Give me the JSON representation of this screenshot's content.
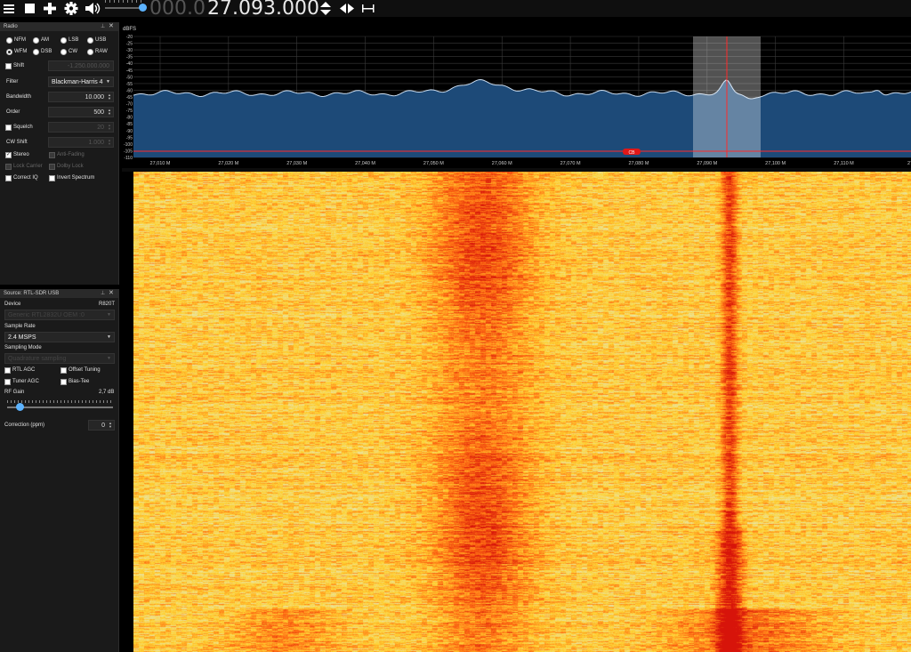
{
  "toolbar": {
    "menu_icon": "hamburger-menu-icon",
    "stop_icon": "stop-icon",
    "add_icon": "plus-icon",
    "settings_icon": "gear-icon",
    "volume_icon": "speaker-icon",
    "volume_level": 0.85,
    "frequency_leading": "000.0",
    "frequency_main": "27.093.000",
    "tuning_icon": "up-down-arrows-icon",
    "center_icon": "left-right-arrows-icon",
    "snap_icon": "snap-interval-icon"
  },
  "radio_panel": {
    "title": "Radio",
    "modes": [
      "NFM",
      "AM",
      "LSB",
      "USB",
      "WFM",
      "DSB",
      "CW",
      "RAW"
    ],
    "selected_mode": "WFM",
    "shift_label": "Shift",
    "shift_value": "-1.250.000.000",
    "filter_label": "Filter",
    "filter_value": "Blackman-Harris 4",
    "bandwidth_label": "Bandwidth",
    "bandwidth_value": "10.000",
    "order_label": "Order",
    "order_value": "500",
    "squelch_label": "Squelch",
    "squelch_value": "20",
    "cw_shift_label": "CW Shift",
    "cw_shift_value": "1.000",
    "stereo_label": "Stereo",
    "anti_fading_label": "Anti-Fading",
    "lock_carrier_label": "Lock Carrier",
    "dolby_label": "Dolby Lock",
    "correct_iq_label": "Correct IQ",
    "invert_spectrum_label": "Invert Spectrum"
  },
  "source_panel": {
    "title": "Source: RTL-SDR USB",
    "device_label": "Device",
    "tuner": "R820T",
    "device_value": "Generic RTL2832U OEM :0",
    "sample_rate_label": "Sample Rate",
    "sample_rate_value": "2.4 MSPS",
    "sampling_mode_label": "Sampling Mode",
    "sampling_mode_value": "Quadrature sampling",
    "rtl_agc_label": "RTL AGC",
    "offset_tuning_label": "Offset Tuning",
    "tuner_agc_label": "Tuner AGC",
    "bias_tee_label": "Bias-Tee",
    "rf_gain_label": "RF Gain",
    "rf_gain_value": "2,7 dB",
    "correction_label": "Correction (ppm)",
    "correction_value": "0"
  },
  "spectrum": {
    "unit": "dBFS",
    "db_labels": [
      "-20",
      "-25",
      "-30",
      "-35",
      "-40",
      "-45",
      "-50",
      "-55",
      "-60",
      "-65",
      "-70",
      "-75",
      "-80",
      "-85",
      "-90",
      "-95",
      "-100",
      "-105",
      "-110"
    ],
    "freq_labels": [
      "27,010 M",
      "27,020 M",
      "27,030 M",
      "27,040 M",
      "27,050 M",
      "27,060 M",
      "27,070 M",
      "27,080 M",
      "27,090 M",
      "27,100 M",
      "27,110 M",
      "27,1"
    ],
    "bookmark_label": "CB",
    "colors": {
      "fill": "#1d4a78",
      "line": "#c9dcf0",
      "vfo": "#ff2a2a",
      "bookmark": "#e01818"
    }
  }
}
